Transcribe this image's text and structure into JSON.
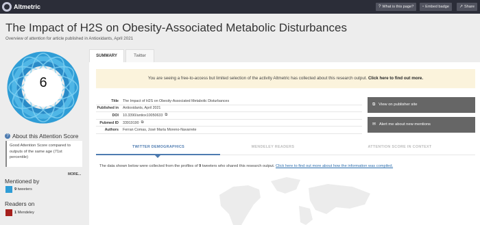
{
  "topbar": {
    "brand": "Altmetric",
    "buttons": [
      {
        "icon": "question-icon",
        "label": "What is this page?"
      },
      {
        "icon": "code-icon",
        "label": "Embed badge"
      },
      {
        "icon": "share-icon",
        "label": "Share"
      }
    ]
  },
  "header": {
    "title": "The Impact of H2S on Obesity-Associated Metabolic Disturbances",
    "subtitle": "Overview of attention for article published in Antioxidants, April 2021"
  },
  "score": {
    "value": "6",
    "colors": {
      "twitter": "#2f9dd6"
    }
  },
  "about": {
    "heading": "About this Attention Score",
    "text": "Good Attention Score compared to outputs of the same age (71st percentile)",
    "more": "MORE..."
  },
  "mentioned_by": {
    "heading": "Mentioned by",
    "items": [
      {
        "count": "9",
        "label": "tweeters",
        "color": "#2f9dd6"
      }
    ]
  },
  "readers_on": {
    "heading": "Readers on",
    "items": [
      {
        "count": "1",
        "label": "Mendeley",
        "color": "#a6201d"
      }
    ]
  },
  "tabs": [
    {
      "label": "SUMMARY"
    },
    {
      "label": "Twitter"
    }
  ],
  "notice": {
    "text": "You are seeing a free-to-access but limited selection of the activity Altmetric has collected about this research output.",
    "link": "Click here to find out more."
  },
  "meta": [
    {
      "key": "Title",
      "value": "The Impact of H2S on Obesity-Associated Metabolic Disturbances",
      "ext": false
    },
    {
      "key": "Published in",
      "value": "Antioxidants, April 2021",
      "ext": false
    },
    {
      "key": "DOI",
      "value": "10.3390/antiox10050633",
      "ext": true
    },
    {
      "key": "Pubmed ID",
      "value": "33919190",
      "ext": true
    },
    {
      "key": "Authors",
      "value": "Ferran Comas, José María Moreno-Navarrete",
      "ext": false
    }
  ],
  "actions": {
    "publisher": "View on publisher site",
    "alert": "Alert me about new mentions"
  },
  "subtabs": [
    {
      "label": "TWITTER DEMOGRAPHICS",
      "active": true
    },
    {
      "label": "MENDELEY READERS",
      "active": false
    },
    {
      "label": "ATTENTION SCORE IN CONTEXT",
      "active": false
    }
  ],
  "demographics": {
    "text_before": "The data shown below were collected from the profiles of ",
    "count": "9",
    "text_after": " tweeters who shared this research output. ",
    "link": "Click here to find out more about how the information was compiled."
  }
}
